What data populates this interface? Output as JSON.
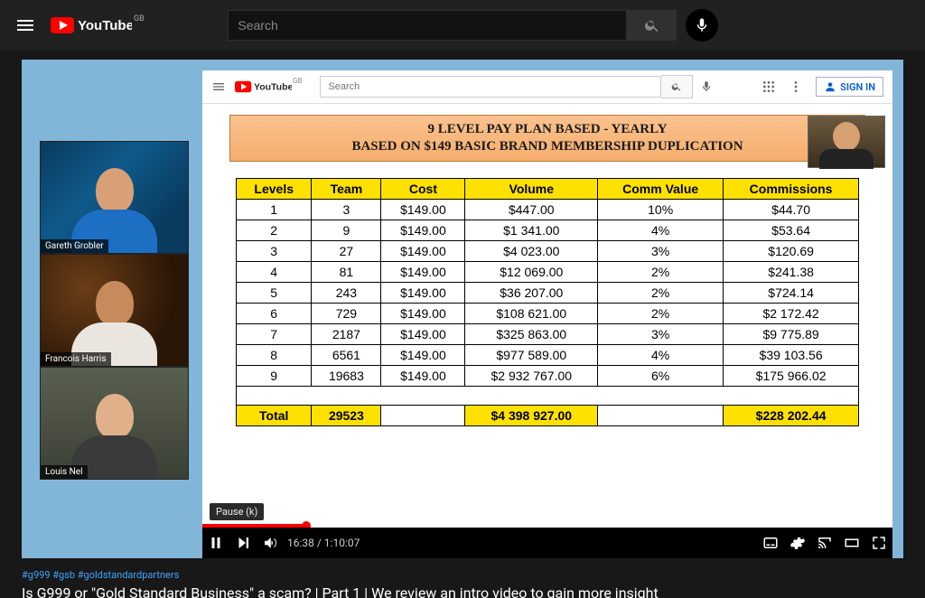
{
  "locale": "GB",
  "search_placeholder": "Search",
  "inner": {
    "locale": "GB",
    "search_placeholder": "Search",
    "signin_label": "SIGN IN"
  },
  "webcams": [
    {
      "name": "Gareth Grobler"
    },
    {
      "name": "Francois Harris"
    },
    {
      "name": "Louis Nel"
    }
  ],
  "slide": {
    "title_line1": "9 LEVEL PAY PLAN BASED - YEARLY",
    "title_line2": "BASED ON $149 BASIC BRAND MEMBERSHIP DUPLICATION",
    "headers": [
      "Levels",
      "Team",
      "Cost",
      "Volume",
      "Comm Value",
      "Commissions"
    ],
    "rows": [
      {
        "level": "1",
        "team": "3",
        "cost": "$149.00",
        "volume": "$447.00",
        "cv": "10%",
        "comm": "$44.70"
      },
      {
        "level": "2",
        "team": "9",
        "cost": "$149.00",
        "volume": "$1 341.00",
        "cv": "4%",
        "comm": "$53.64"
      },
      {
        "level": "3",
        "team": "27",
        "cost": "$149.00",
        "volume": "$4 023.00",
        "cv": "3%",
        "comm": "$120.69"
      },
      {
        "level": "4",
        "team": "81",
        "cost": "$149.00",
        "volume": "$12 069.00",
        "cv": "2%",
        "comm": "$241.38"
      },
      {
        "level": "5",
        "team": "243",
        "cost": "$149.00",
        "volume": "$36 207.00",
        "cv": "2%",
        "comm": "$724.14"
      },
      {
        "level": "6",
        "team": "729",
        "cost": "$149.00",
        "volume": "$108 621.00",
        "cv": "2%",
        "comm": "$2 172.42"
      },
      {
        "level": "7",
        "team": "2187",
        "cost": "$149.00",
        "volume": "$325 863.00",
        "cv": "3%",
        "comm": "$9 775.89"
      },
      {
        "level": "8",
        "team": "6561",
        "cost": "$149.00",
        "volume": "$977 589.00",
        "cv": "4%",
        "comm": "$39 103.56"
      },
      {
        "level": "9",
        "team": "19683",
        "cost": "$149.00",
        "volume": "$2 932 767.00",
        "cv": "6%",
        "comm": "$175 966.02"
      }
    ],
    "total": {
      "label": "Total",
      "team": "29523",
      "cost": "",
      "volume": "$4 398 927.00",
      "cv": "",
      "comm": "$228 202.44"
    }
  },
  "player": {
    "tooltip": "Pause (k)",
    "current": "16:38",
    "sep": " / ",
    "duration": "1:10:07"
  },
  "tags": "#g999 #gsb #goldstandardpartners",
  "video_title": "Is G999 or \"Gold Standard Business\" a scam? | Part 1 | We review an intro video to gain more insight",
  "chart_data": {
    "type": "table",
    "title": "9 Level Pay Plan Based - Yearly ($149 membership duplication)",
    "columns": [
      "Levels",
      "Team",
      "Cost",
      "Volume",
      "Comm Value",
      "Commissions"
    ],
    "rows": [
      [
        1,
        3,
        149.0,
        447.0,
        0.1,
        44.7
      ],
      [
        2,
        9,
        149.0,
        1341.0,
        0.04,
        53.64
      ],
      [
        3,
        27,
        149.0,
        4023.0,
        0.03,
        120.69
      ],
      [
        4,
        81,
        149.0,
        12069.0,
        0.02,
        241.38
      ],
      [
        5,
        243,
        149.0,
        36207.0,
        0.02,
        724.14
      ],
      [
        6,
        729,
        149.0,
        108621.0,
        0.02,
        2172.42
      ],
      [
        7,
        2187,
        149.0,
        325863.0,
        0.03,
        9775.89
      ],
      [
        8,
        6561,
        149.0,
        977589.0,
        0.04,
        39103.56
      ],
      [
        9,
        19683,
        149.0,
        2932767.0,
        0.06,
        175966.02
      ]
    ],
    "totals": {
      "Team": 29523,
      "Volume": 4398927.0,
      "Commissions": 228202.44
    }
  }
}
